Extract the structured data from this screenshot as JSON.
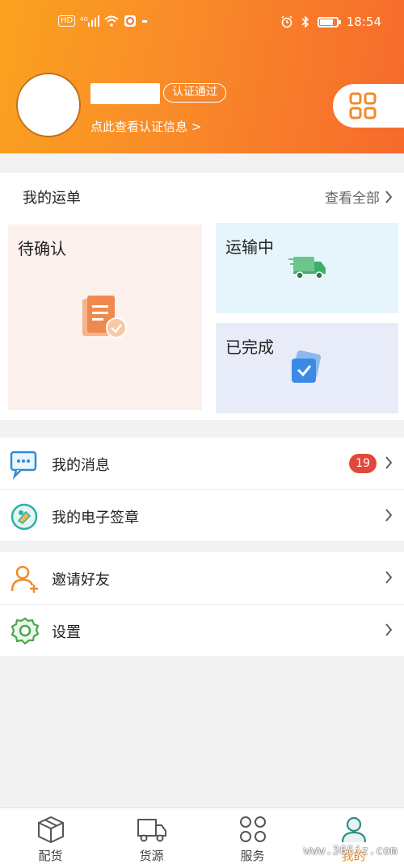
{
  "status_bar": {
    "network_chip": "HD",
    "signal_label": "4G",
    "time": "18:54"
  },
  "profile": {
    "verified_badge": "认证通过",
    "view_auth_link": "点此查看认证信息 >"
  },
  "orders": {
    "title": "我的运单",
    "view_all": "查看全部",
    "tiles": {
      "pending": "待确认",
      "in_transit": "运输中",
      "completed": "已完成"
    }
  },
  "menu": {
    "messages": {
      "label": "我的消息",
      "badge": "19"
    },
    "e_seal": {
      "label": "我的电子签章"
    },
    "invite": {
      "label": "邀请好友"
    },
    "settings": {
      "label": "设置"
    }
  },
  "bottom_nav": [
    {
      "label": "配货",
      "icon": "package-icon"
    },
    {
      "label": "货源",
      "icon": "truck-icon"
    },
    {
      "label": "服务",
      "icon": "grid-icon"
    },
    {
      "label": "我的",
      "icon": "user-icon"
    }
  ],
  "active_tab": "我的",
  "colors": {
    "header_gradient_start": "#fba21f",
    "header_gradient_end": "#f66a2c",
    "accent": "#f08a2a",
    "badge": "#e2473c"
  },
  "watermark": "www.365jz.com"
}
